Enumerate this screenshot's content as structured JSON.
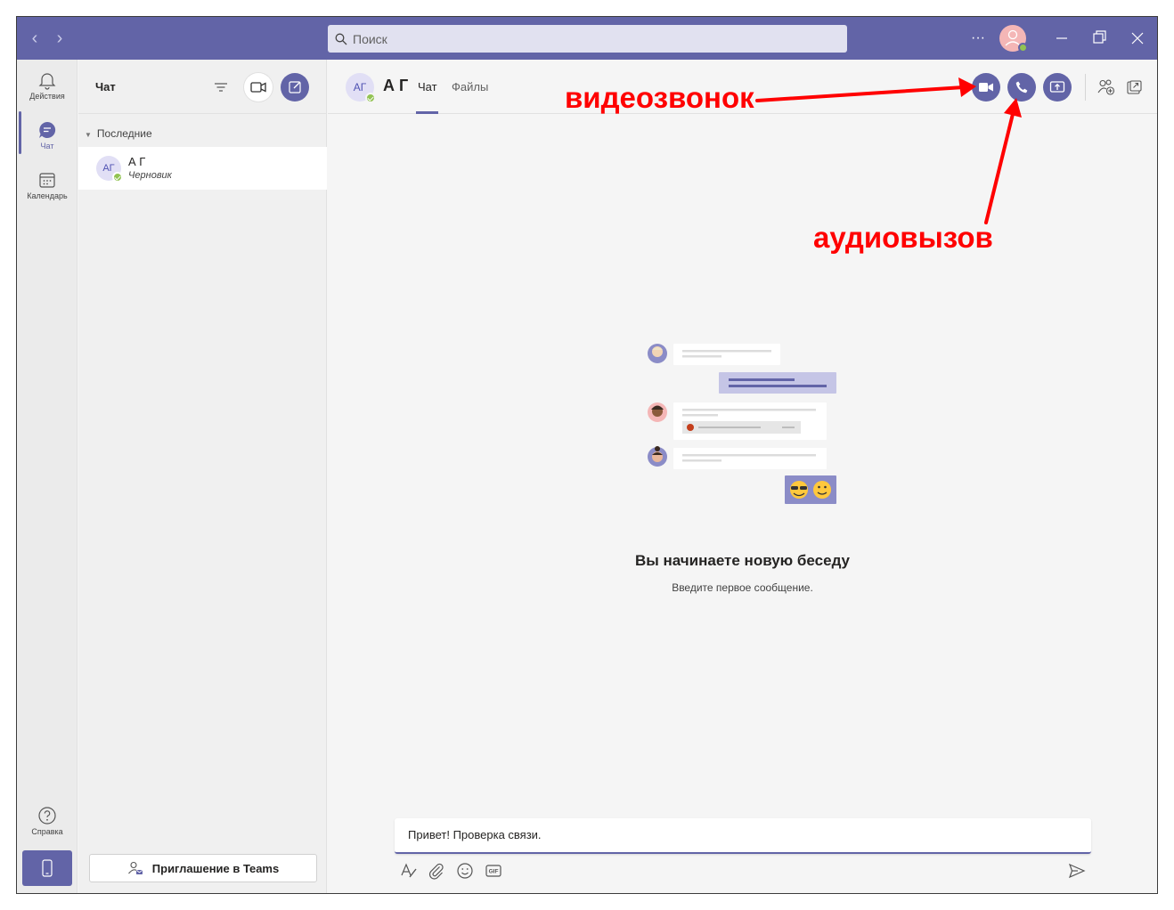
{
  "titlebar": {
    "search_placeholder": "Поиск",
    "more_glyph": "···",
    "colors": {
      "bar": "#6264a7"
    }
  },
  "rail": {
    "items": [
      {
        "label": "Действия",
        "icon": "bell-icon"
      },
      {
        "label": "Чат",
        "icon": "chat-icon",
        "active": true
      },
      {
        "label": "Календарь",
        "icon": "calendar-icon"
      }
    ],
    "help_label": "Справка"
  },
  "chatlist": {
    "title": "Чат",
    "section": "Последние",
    "chats": [
      {
        "initials": "АГ",
        "name": "А Г",
        "status": "Черновик"
      }
    ],
    "invite_label": "Приглашение в Teams"
  },
  "conversation": {
    "initials": "АГ",
    "name": "А Г",
    "tabs": [
      "Чат",
      "Файлы"
    ],
    "empty_title": "Вы начинаете новую беседу",
    "empty_subtitle": "Введите первое сообщение.",
    "composer_value": "Привет! Проверка связи."
  },
  "annotations": {
    "video_call": "видеозвонок",
    "audio_call": "аудиовызов",
    "color": "#ff0000"
  }
}
